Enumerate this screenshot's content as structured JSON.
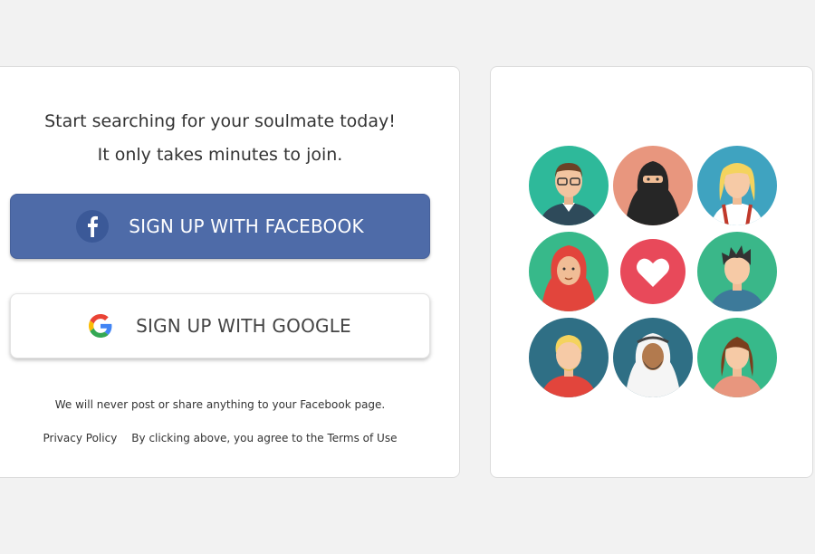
{
  "signup": {
    "headline_line1": "Start searching for your soulmate today!",
    "headline_line2": "It only takes minutes to join.",
    "facebook_label": "SIGN UP WITH FACEBOOK",
    "google_label": "SIGN UP WITH GOOGLE",
    "privacy_note": "We will never post or share anything to your Facebook page.",
    "privacy_policy_link": "Privacy Policy",
    "terms_text": "By clicking above, you agree to the Terms of Use"
  },
  "colors": {
    "facebook": "#4e6ba8",
    "heart": "#e8495a",
    "page_background": "#f2f2f2"
  },
  "illustration": {
    "avatars": [
      "man-glasses-icon",
      "woman-niqab-icon",
      "blonde-woman-icon",
      "woman-hijab-icon",
      "heart-icon",
      "young-man-icon",
      "blond-man-icon",
      "arab-man-icon",
      "brunette-woman-icon"
    ]
  }
}
